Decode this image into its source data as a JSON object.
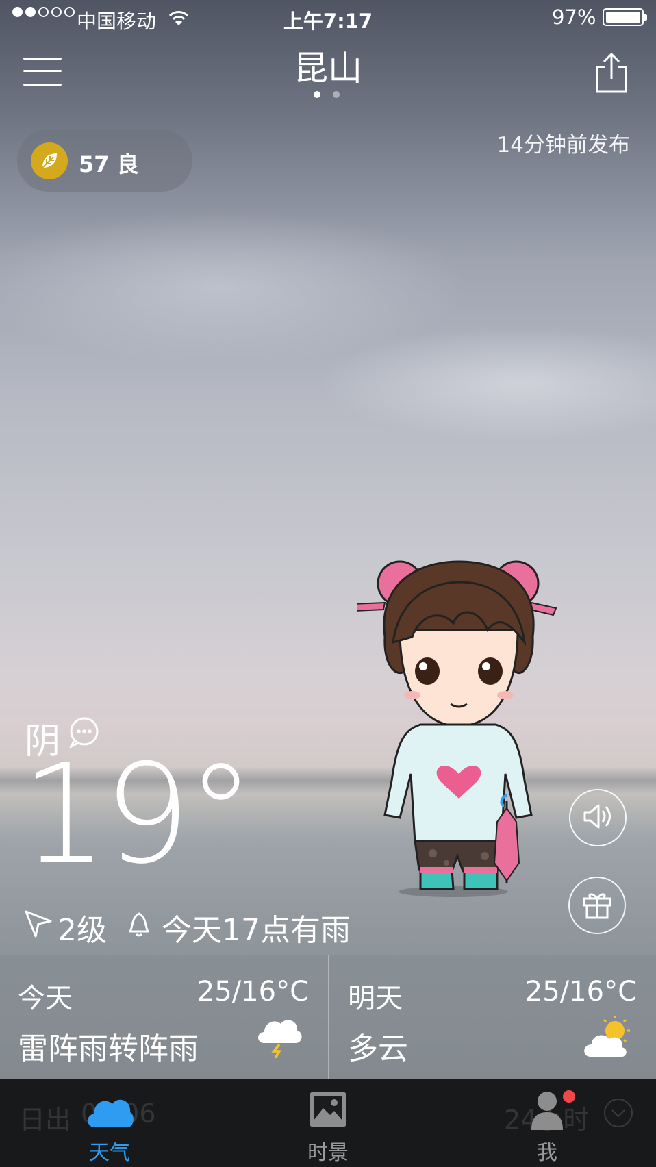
{
  "status_bar": {
    "carrier": "中国移动",
    "time": "上午7:17",
    "battery": "97%",
    "battery_level": 0.97,
    "signal_bars_filled": 2,
    "signal_bars_total": 5
  },
  "header": {
    "city": "昆山",
    "page_count": 2,
    "active_page": 1
  },
  "aqi": {
    "value": "57",
    "level": "良",
    "color": "#d5a91c"
  },
  "published": "14分钟前发布",
  "current": {
    "condition": "阴",
    "temperature": "19°",
    "wind": "2级",
    "rain_alert": "今天17点有雨"
  },
  "forecast": [
    {
      "day": "今天",
      "range": "25/16°C",
      "desc": "雷阵雨转阵雨",
      "icon": "thunderstorm-icon"
    },
    {
      "day": "明天",
      "range": "25/16°C",
      "desc": "多云",
      "icon": "partly-cloudy-icon"
    }
  ],
  "hidden_row": {
    "sunrise_label": "日出",
    "sunrise_time": "05:06",
    "hours_label": "24小时"
  },
  "tabs": [
    {
      "label": "天气",
      "icon": "cloud-icon",
      "active": true
    },
    {
      "label": "时景",
      "icon": "photo-icon",
      "active": false
    },
    {
      "label": "我",
      "icon": "user-icon",
      "active": false,
      "badge": true
    }
  ],
  "colors": {
    "accent": "#2e9cf0",
    "aqi": "#d5a91c",
    "badge": "#f04848"
  }
}
